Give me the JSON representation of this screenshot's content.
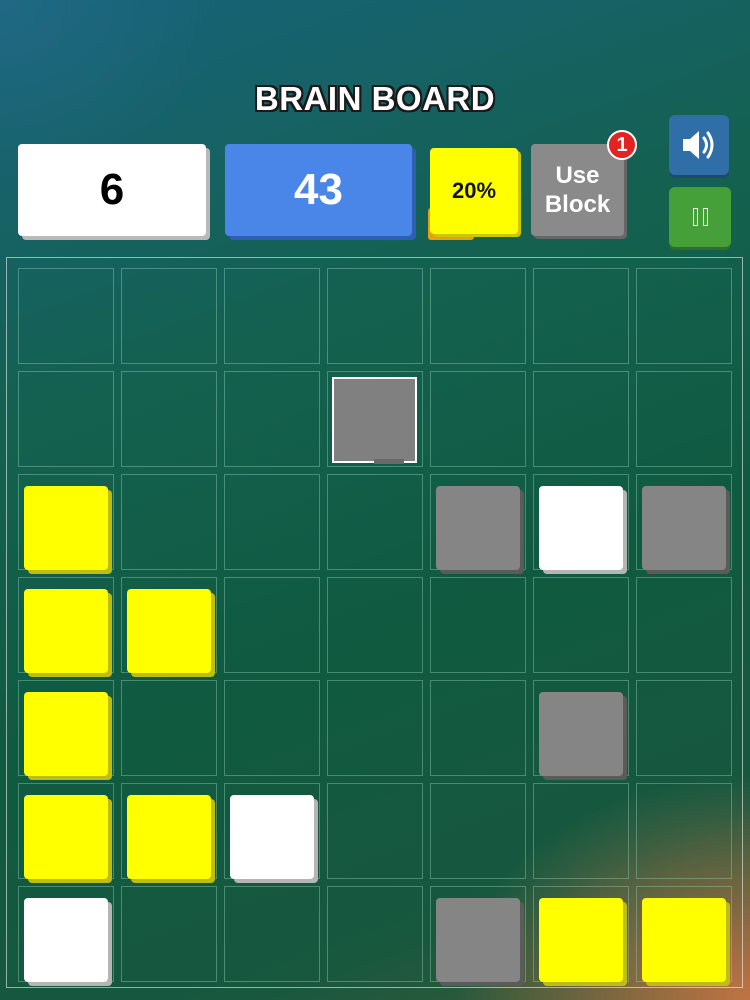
{
  "title": "BRAIN BOARD",
  "hud": {
    "level": "6",
    "score": "43",
    "progress_label": "20%",
    "progress_value": 20,
    "use_block_label_line1": "Use",
    "use_block_label_line2": "Block",
    "use_block_count": "1"
  },
  "controls": {
    "sound_icon": "speaker-volume-icon",
    "pause_icon": "pause-icon"
  },
  "colors": {
    "yellow": "#ffff00",
    "white": "#ffffff",
    "gray": "#858585",
    "score_blue": "#4a86e8",
    "sound_blue": "#2f6ea6",
    "pause_green": "#46a03a",
    "badge_red": "#e32222"
  },
  "board": {
    "rows": 7,
    "cols": 7,
    "tiles": [
      {
        "row": 2,
        "col": 0,
        "color": "yellow"
      },
      {
        "row": 2,
        "col": 4,
        "color": "gray"
      },
      {
        "row": 2,
        "col": 5,
        "color": "white"
      },
      {
        "row": 2,
        "col": 6,
        "color": "gray"
      },
      {
        "row": 3,
        "col": 0,
        "color": "yellow"
      },
      {
        "row": 3,
        "col": 1,
        "color": "yellow"
      },
      {
        "row": 4,
        "col": 0,
        "color": "yellow"
      },
      {
        "row": 4,
        "col": 5,
        "color": "gray"
      },
      {
        "row": 5,
        "col": 0,
        "color": "yellow"
      },
      {
        "row": 5,
        "col": 1,
        "color": "yellow"
      },
      {
        "row": 5,
        "col": 2,
        "color": "white"
      },
      {
        "row": 6,
        "col": 0,
        "color": "white"
      },
      {
        "row": 6,
        "col": 4,
        "color": "gray"
      },
      {
        "row": 6,
        "col": 5,
        "color": "yellow"
      },
      {
        "row": 6,
        "col": 6,
        "color": "yellow"
      }
    ],
    "preview": {
      "row": 1,
      "col": 3,
      "color": "gray"
    }
  }
}
